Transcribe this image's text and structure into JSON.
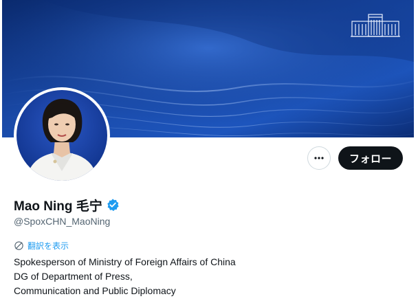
{
  "profile": {
    "display_name": "Mao Ning 毛宁",
    "handle": "@SpoxCHN_MaoNing",
    "verified": true,
    "bio_lines": [
      "Spokesperson of Ministry of Foreign Affairs of China",
      "DG of Department of Press,",
      "Communication and Public Diplomacy"
    ]
  },
  "actions": {
    "follow_label": "フォロー",
    "translate_label": "翻訳を表示"
  },
  "icons": {
    "more": "more-horizontal-icon",
    "verified": "verified-badge-icon",
    "translate": "translate-globe-icon",
    "emblem": "building-emblem-icon"
  },
  "colors": {
    "banner": "#143a86",
    "follow_button": "#0f1419",
    "link": "#1d9bf0",
    "verified": "#1d9bf0",
    "secondary_text": "#536471"
  }
}
